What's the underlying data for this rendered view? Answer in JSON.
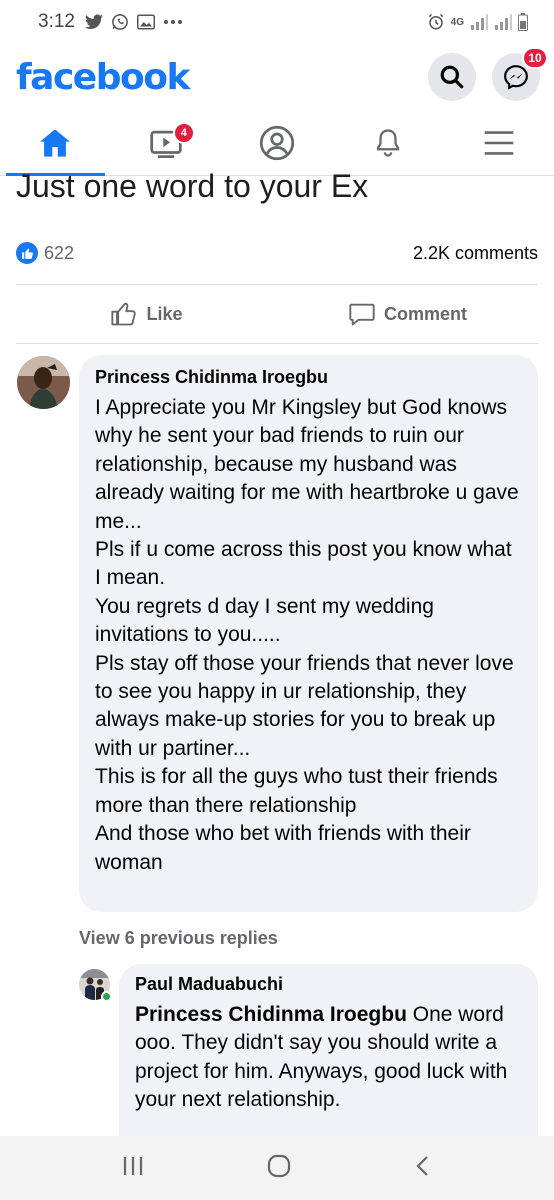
{
  "status_bar": {
    "time": "3:12",
    "network": "4G",
    "icons_left": [
      "twitter-icon",
      "whatsapp-icon",
      "gallery-icon",
      "more-dots-icon"
    ],
    "icons_right": [
      "alarm-icon",
      "signal-icon",
      "signal-icon",
      "battery-icon"
    ]
  },
  "header": {
    "logo": "facebook",
    "messenger_badge": "10"
  },
  "nav": {
    "tabs": [
      {
        "name": "home",
        "active": true
      },
      {
        "name": "watch",
        "badge": "4"
      },
      {
        "name": "profile"
      },
      {
        "name": "notifications"
      },
      {
        "name": "menu"
      }
    ]
  },
  "post": {
    "text": "Just one word to your Ex",
    "reactions_count": "622",
    "comments_count": "2.2K comments",
    "like_label": "Like",
    "comment_label": "Comment"
  },
  "comments": [
    {
      "author": "Princess Chidinma Iroegbu",
      "body": "I Appreciate you Mr Kingsley but God knows  why he sent your bad friends to ruin our relationship, because my husband was already waiting for me with heartbroke u gave me...\nPls if u come across this post you know what I mean.\nYou regrets d day I sent my wedding invitations to you.....\nPls stay off those your friends that never love to see you happy in ur relationship, they always make-up stories for you to break up with ur partiner...\nThis is for all the guys who tust their friends more than there relationship\nAnd those who bet with friends with their woman"
    }
  ],
  "view_replies": "View 6 previous replies",
  "reply": {
    "author": "Paul Maduabuchi",
    "mention": "Princess Chidinma Iroegbu",
    "body": " One word ooo. They didn't say you should write a project for him. Anyways, good luck with your next relationship."
  },
  "colors": {
    "brand": "#1877f2",
    "badge": "#e41e3f",
    "bubble": "#f0f2f5",
    "online": "#31a24c"
  }
}
